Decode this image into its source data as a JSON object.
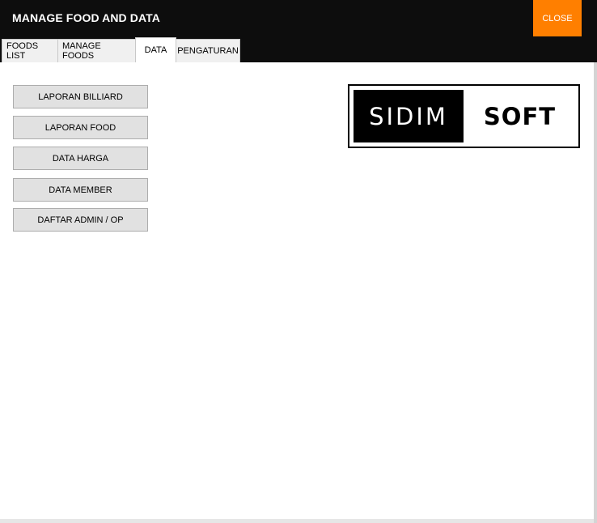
{
  "window": {
    "title": "MANAGE FOOD AND DATA",
    "close_label": "CLOSE"
  },
  "tabs": [
    {
      "label": "FOODS LIST",
      "active": false
    },
    {
      "label": "MANAGE FOODS",
      "active": false
    },
    {
      "label": "DATA",
      "active": true
    },
    {
      "label": "PENGATURAN",
      "active": false
    }
  ],
  "data_panel": {
    "buttons": [
      {
        "label": "LAPORAN BILLIARD"
      },
      {
        "label": "LAPORAN FOOD"
      },
      {
        "label": "DATA HARGA"
      },
      {
        "label": "DATA MEMBER"
      },
      {
        "label": "DAFTAR ADMIN / OP"
      }
    ],
    "logo": {
      "left_text": "SIDIM",
      "right_text": "SOFT"
    }
  },
  "colors": {
    "title_bar": "#0d0d0d",
    "close_button": "#ff7f00",
    "button_bg": "#e1e1e1"
  }
}
